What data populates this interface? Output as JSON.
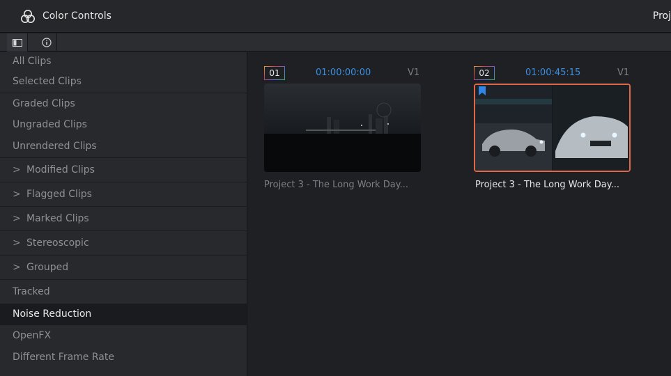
{
  "header": {
    "title": "Color Controls",
    "right_title": "Proj"
  },
  "toolbar": {
    "panel_toggle_icon": "sidebar-panel-icon",
    "info_icon": "info-icon"
  },
  "sidebar": {
    "items": [
      {
        "label": "All Clips",
        "chevron": false
      },
      {
        "label": "Selected Clips",
        "chevron": false
      },
      {
        "label": "Graded Clips",
        "chevron": false
      },
      {
        "label": "Ungraded Clips",
        "chevron": false
      },
      {
        "label": "Unrendered Clips",
        "chevron": false
      },
      {
        "label": "Modified Clips",
        "chevron": true
      },
      {
        "label": "Flagged Clips",
        "chevron": true
      },
      {
        "label": "Marked Clips",
        "chevron": true
      },
      {
        "label": "Stereoscopic",
        "chevron": true
      },
      {
        "label": "Grouped",
        "chevron": true
      },
      {
        "label": "Tracked",
        "chevron": false
      },
      {
        "label": "Noise Reduction",
        "chevron": false,
        "selected": true
      },
      {
        "label": "OpenFX",
        "chevron": false
      },
      {
        "label": "Different Frame Rate",
        "chevron": false
      }
    ],
    "chevron_glyph": ">"
  },
  "clips": [
    {
      "number": "01",
      "timecode": "01:00:00:00",
      "track": "V1",
      "name": "Project 3 - The Long Work Day...",
      "selected": false,
      "flagged": false
    },
    {
      "number": "02",
      "timecode": "01:00:45:15",
      "track": "V1",
      "name": "Project 3 - The Long Work Day...",
      "selected": true,
      "flagged": true
    }
  ],
  "colors": {
    "accent_timecode": "#3b8ee0",
    "selection_border": "#e06848",
    "flag": "#2f86e6"
  }
}
